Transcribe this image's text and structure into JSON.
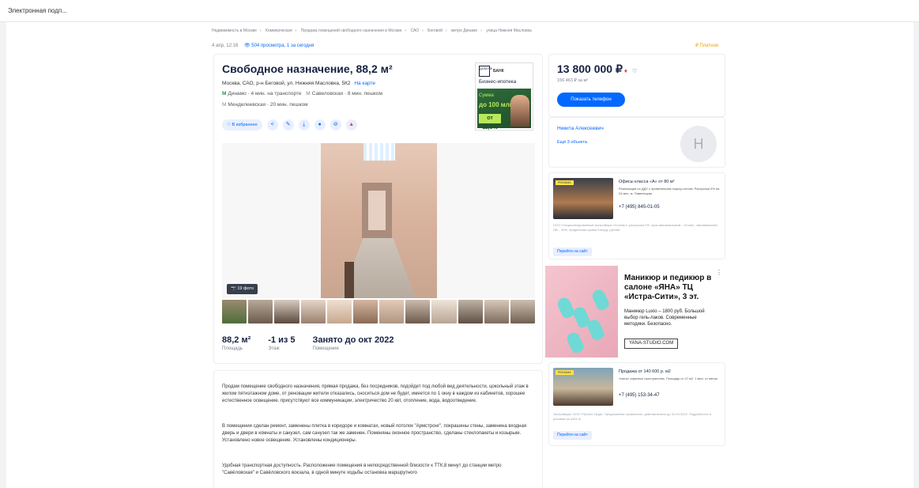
{
  "browser": {
    "tab_title": "Электронная подп..."
  },
  "breadcrumbs": [
    "Недвижимость в Москве",
    "Коммерческая",
    "Продажа помещений свободного назначения в Москве",
    "САО",
    "Беговой",
    "метро Динамо",
    "улица Нижняя Масловка"
  ],
  "meta": {
    "date": "4 апр, 12:16",
    "views": "504 просмотра, 1 за сегодня",
    "paid": "₽ Платное"
  },
  "listing": {
    "title": "Свободное назначение, 88,2 м²",
    "address": "Москва, САО, р-н Беговой, ул. Нижняя Масловка, 5К2",
    "map_link": "На карте",
    "metro": [
      {
        "icon": "М",
        "name": "Динамо",
        "time": "· 4 мин. на транспорте"
      },
      {
        "icon": "М",
        "name": "Савеловская",
        "time": "· 8 мин. пешком"
      },
      {
        "icon": "М",
        "name": "Менделеевская",
        "time": "· 20 мин. пешком"
      }
    ],
    "favorite": "♡ В избранное",
    "action_icons": [
      "share-icon",
      "edit-icon",
      "download-icon",
      "print-icon",
      "hide-icon",
      "complaint-icon"
    ],
    "photo_count": "📷 19 фото",
    "stats": [
      {
        "value": "88,2 м²",
        "label": "Площадь"
      },
      {
        "value": "-1 из 5",
        "label": "Этаж"
      },
      {
        "value": "Занято до окт 2022",
        "label": "Помещение"
      }
    ],
    "description": [
      "Продам помещение свободного назначения, прямая продажа, без посредников, подойдет под любой вид деятельности, цокольный этаж в жилом пятиэтажном доме, от реновации жители отказались, сноситься дом не будет, имеется по 1 окну в каждом из кабинетов, хорошее естественное освещение, присутствуют все коммуникации, электричество 20 квт, отопление, вода, водоотведение.",
      "В помещении сделан ремонт, заменены плитка в коридоре и комнатах, новый потолок \"Армстронг\", покрашены стены, заменена входная дверь и двери в комнаты и санузел, сам санузел так же заменен. Поменяны оконное пространство, сделаны стеклопакеты и козырьки. Установлено новое освещение. Установлены кондиционеры.",
      "Удобная транспортная доступность. Расположение помещения в непосредственной близости к ТТК,8 минут до станции метро \"Савёловская\" и Савёловского вокзала, в одной минуте ходьбы остановка маршрутного"
    ]
  },
  "mortgage_ad": {
    "logo": "ДОМ.РФ",
    "bank": "БАНК",
    "title": "Бизнес-ипотека",
    "sum_label": "Сумма",
    "sum": "до 100 млн",
    "rate": "от 11,5%"
  },
  "price": {
    "value": "13 800 000 ₽",
    "arrow": "♦",
    "heart": "♡",
    "per_m": "156 463 ₽ за м²",
    "phone_button": "Показать телефон"
  },
  "agent": {
    "name": "Никита Алексеевич",
    "more": "Ещё 3 объекта",
    "avatar_letter": "Н"
  },
  "ad_offices": {
    "badge": "РЕКЛАМА",
    "title": "Офисы класса «А» от 80 м²",
    "text": "Реализация по ДДУ с применением эскроу-счетов. Рассрочка 0% на 24 мес. м. Павелецкая",
    "phone": "+7 (495) 845-01-05",
    "legal": "ООО Специализированный застройщик «Холлер», рассрочка 0%, срок максимальный – 24 мес., минимальный ПВ – 30%, предельная сумма 5 млрд. рублей",
    "link": "Перейти на сайт"
  },
  "ad_nails": {
    "title": "Маникюр и педикюр в салоне «ЯНА» ТЦ «Истра-Сити», 3 эт.",
    "text": "Маникюр Luxio – 1800 руб. Большой выбор гель-лаков. Современные методики. Безопасно.",
    "site": "YANA-STUDIO.COM",
    "dots": "⋮"
  },
  "ad_spaces": {
    "badge": "РЕКЛАМА",
    "title": "Продажа от 140 600 р. м2",
    "text": "«Iskra» офисные пространства. Площадь от 47 м2. 1 мин. от метро",
    "phone": "+7 (495) 153-34-47",
    "legal": "Застройщик: ООО «Проект-Град». Предложение ограничено, действительно до 31.03.2022. Подробности и условия на а101.ru",
    "link": "Перейти на сайт"
  },
  "colors": {
    "accent": "#0468ff",
    "metro_green": "#1a9b3f",
    "price_arrow": "#e84260"
  }
}
